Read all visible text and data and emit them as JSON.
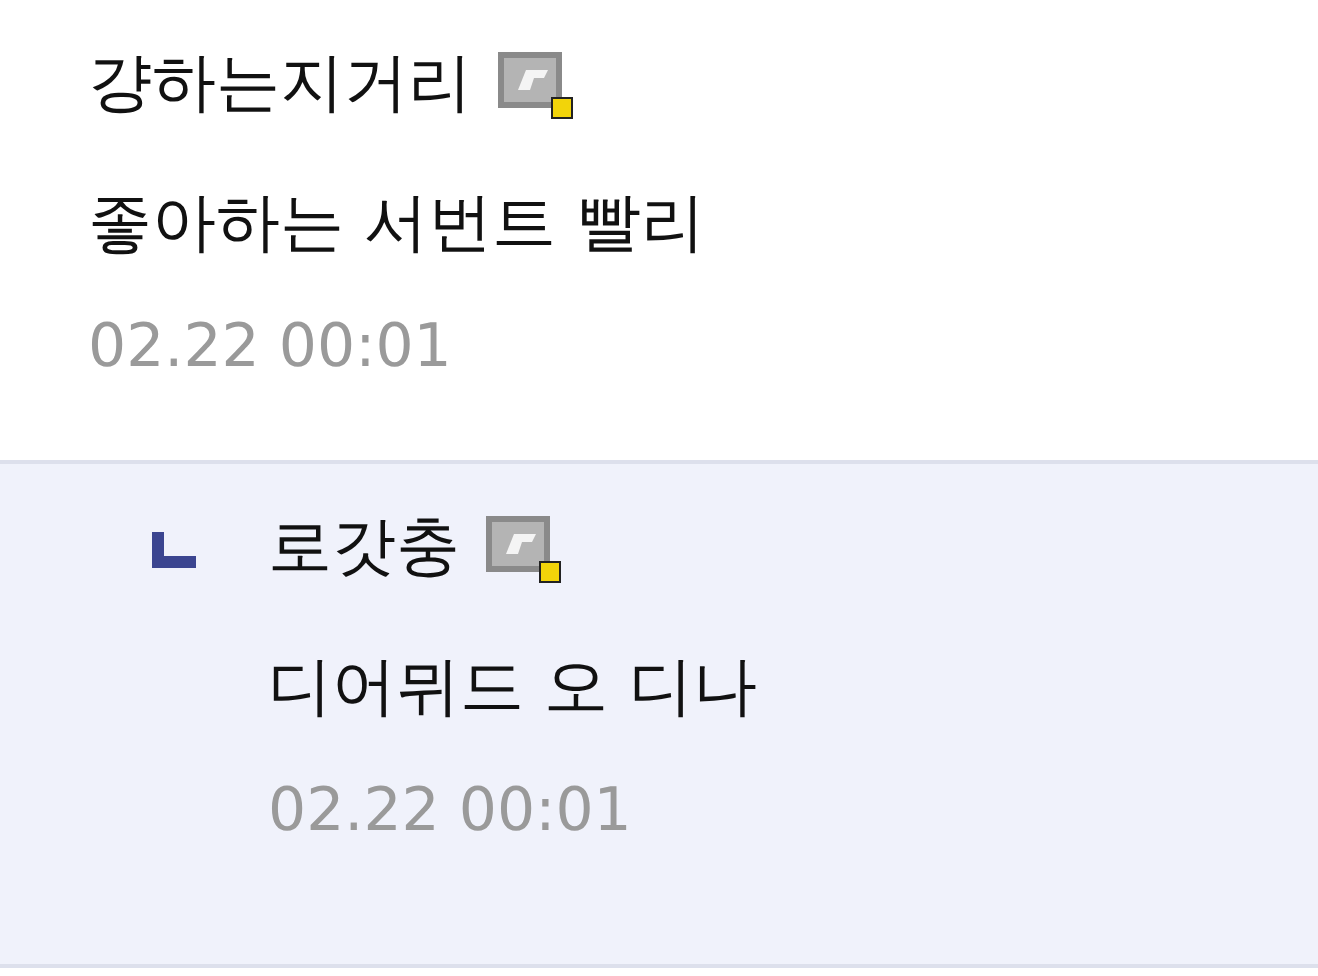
{
  "comments": [
    {
      "kind": "comment",
      "author": "걍하는지거리",
      "text": "좋아하는 서번트 빨리",
      "time": "02.22 00:01"
    },
    {
      "kind": "reply",
      "author": "로갓충",
      "text": "디어뮈드 오 디나",
      "time": "02.22 00:01"
    }
  ]
}
